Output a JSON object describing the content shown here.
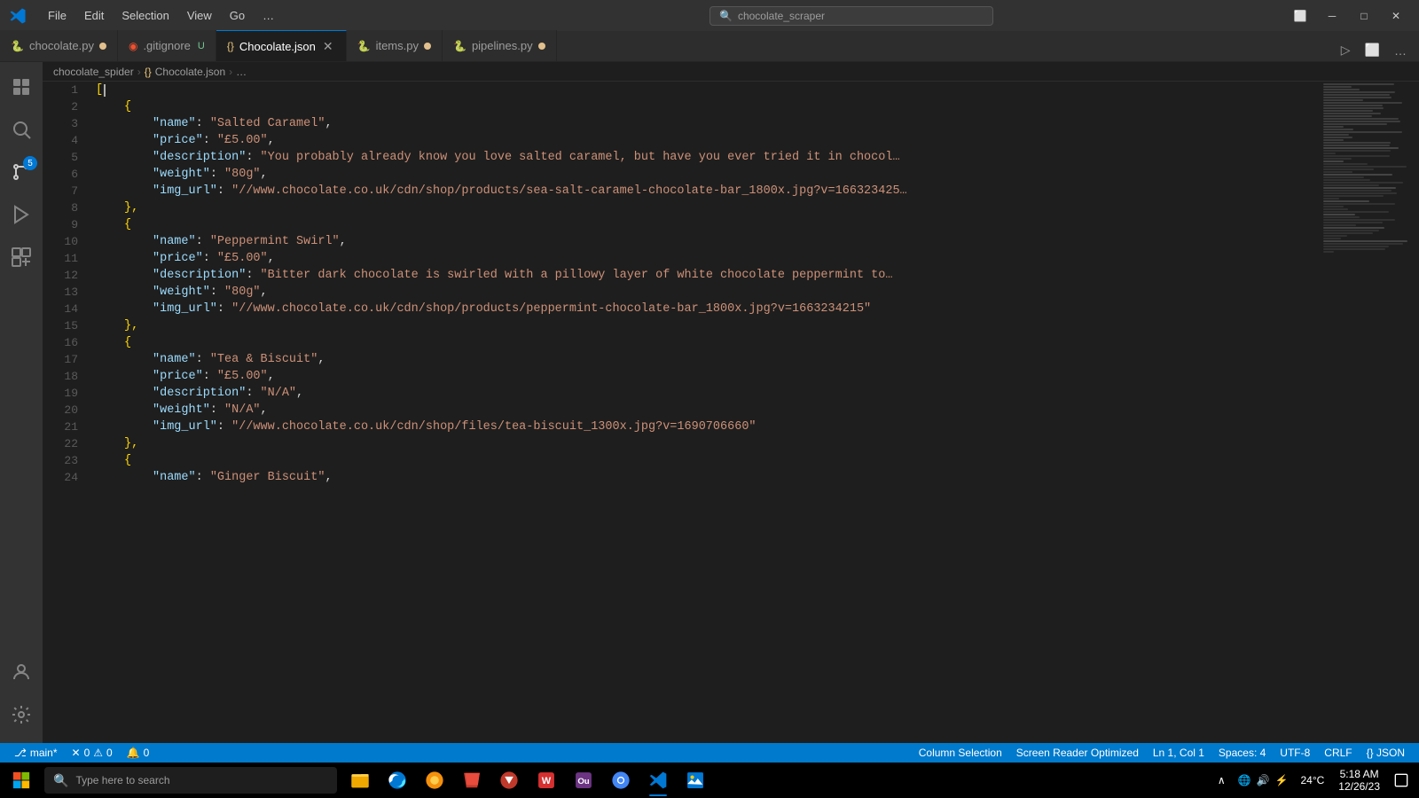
{
  "titlebar": {
    "menu": [
      "File",
      "Edit",
      "Selection",
      "View",
      "Go",
      "…"
    ],
    "search_placeholder": "chocolate_scraper",
    "window_controls": [
      "minimize",
      "maximize",
      "close"
    ]
  },
  "tabs": [
    {
      "id": "chocolate-py",
      "label": "chocolate.py",
      "status": "M",
      "active": false,
      "icon_color": "#4ec9b0"
    },
    {
      "id": "gitignore",
      "label": ".gitignore",
      "status": "U",
      "active": false,
      "icon_color": "#f1502f"
    },
    {
      "id": "chocolate-json",
      "label": "Chocolate.json",
      "status": "",
      "active": true,
      "icon_color": "#e8c47a"
    },
    {
      "id": "items-py",
      "label": "items.py",
      "status": "M",
      "active": false,
      "icon_color": "#4ec9b0"
    },
    {
      "id": "pipelines-py",
      "label": "pipelines.py",
      "status": "M",
      "active": false,
      "icon_color": "#4ec9b0"
    }
  ],
  "breadcrumb": [
    "chocolate_spider",
    "{} Chocolate.json",
    "…"
  ],
  "code_lines": [
    {
      "num": 1,
      "indent": 0,
      "tokens": [
        {
          "type": "bracket",
          "text": "["
        },
        {
          "type": "cursor",
          "text": ""
        }
      ]
    },
    {
      "num": 2,
      "indent": 4,
      "tokens": [
        {
          "type": "brace",
          "text": "{"
        }
      ]
    },
    {
      "num": 3,
      "indent": 8,
      "tokens": [
        {
          "type": "key",
          "text": "\"name\""
        },
        {
          "type": "colon",
          "text": ": "
        },
        {
          "type": "string",
          "text": "\"Salted Caramel\""
        },
        {
          "type": "comma",
          "text": ","
        }
      ]
    },
    {
      "num": 4,
      "indent": 8,
      "tokens": [
        {
          "type": "key",
          "text": "\"price\""
        },
        {
          "type": "colon",
          "text": ": "
        },
        {
          "type": "string",
          "text": "\"£5.00\""
        },
        {
          "type": "comma",
          "text": ","
        }
      ]
    },
    {
      "num": 5,
      "indent": 8,
      "tokens": [
        {
          "type": "key",
          "text": "\"description\""
        },
        {
          "type": "colon",
          "text": ": "
        },
        {
          "type": "string",
          "text": "\"You probably already know you love salted caramel, but have you ever tried it in chocol…"
        }
      ]
    },
    {
      "num": 6,
      "indent": 8,
      "tokens": [
        {
          "type": "key",
          "text": "\"weight\""
        },
        {
          "type": "colon",
          "text": ": "
        },
        {
          "type": "string",
          "text": "\"80g\""
        },
        {
          "type": "comma",
          "text": ","
        }
      ]
    },
    {
      "num": 7,
      "indent": 8,
      "tokens": [
        {
          "type": "key",
          "text": "\"img_url\""
        },
        {
          "type": "colon",
          "text": ": "
        },
        {
          "type": "string",
          "text": "\"//www.chocolate.co.uk/cdn/shop/products/sea-salt-caramel-chocolate-bar_1800x.jpg?v=166323425…"
        }
      ]
    },
    {
      "num": 8,
      "indent": 4,
      "tokens": [
        {
          "type": "brace",
          "text": "},"
        }
      ]
    },
    {
      "num": 9,
      "indent": 4,
      "tokens": [
        {
          "type": "brace",
          "text": "{"
        }
      ]
    },
    {
      "num": 10,
      "indent": 8,
      "tokens": [
        {
          "type": "key",
          "text": "\"name\""
        },
        {
          "type": "colon",
          "text": ": "
        },
        {
          "type": "string",
          "text": "\"Peppermint Swirl\""
        },
        {
          "type": "comma",
          "text": ","
        }
      ]
    },
    {
      "num": 11,
      "indent": 8,
      "tokens": [
        {
          "type": "key",
          "text": "\"price\""
        },
        {
          "type": "colon",
          "text": ": "
        },
        {
          "type": "string",
          "text": "\"£5.00\""
        },
        {
          "type": "comma",
          "text": ","
        }
      ]
    },
    {
      "num": 12,
      "indent": 8,
      "tokens": [
        {
          "type": "key",
          "text": "\"description\""
        },
        {
          "type": "colon",
          "text": ": "
        },
        {
          "type": "string",
          "text": "\"Bitter dark chocolate is swirled with a pillowy layer of white chocolate peppermint to…"
        }
      ]
    },
    {
      "num": 13,
      "indent": 8,
      "tokens": [
        {
          "type": "key",
          "text": "\"weight\""
        },
        {
          "type": "colon",
          "text": ": "
        },
        {
          "type": "string",
          "text": "\"80g\""
        },
        {
          "type": "comma",
          "text": ","
        }
      ]
    },
    {
      "num": 14,
      "indent": 8,
      "tokens": [
        {
          "type": "key",
          "text": "\"img_url\""
        },
        {
          "type": "colon",
          "text": ": "
        },
        {
          "type": "string",
          "text": "\"//www.chocolate.co.uk/cdn/shop/products/peppermint-chocolate-bar_1800x.jpg?v=1663234215\""
        }
      ]
    },
    {
      "num": 15,
      "indent": 4,
      "tokens": [
        {
          "type": "brace",
          "text": "},"
        }
      ]
    },
    {
      "num": 16,
      "indent": 4,
      "tokens": [
        {
          "type": "brace",
          "text": "{"
        }
      ]
    },
    {
      "num": 17,
      "indent": 8,
      "tokens": [
        {
          "type": "key",
          "text": "\"name\""
        },
        {
          "type": "colon",
          "text": ": "
        },
        {
          "type": "string",
          "text": "\"Tea & Biscuit\""
        },
        {
          "type": "comma",
          "text": ","
        }
      ]
    },
    {
      "num": 18,
      "indent": 8,
      "tokens": [
        {
          "type": "key",
          "text": "\"price\""
        },
        {
          "type": "colon",
          "text": ": "
        },
        {
          "type": "string",
          "text": "\"£5.00\""
        },
        {
          "type": "comma",
          "text": ","
        }
      ]
    },
    {
      "num": 19,
      "indent": 8,
      "tokens": [
        {
          "type": "key",
          "text": "\"description\""
        },
        {
          "type": "colon",
          "text": ": "
        },
        {
          "type": "string",
          "text": "\"N/A\""
        },
        {
          "type": "comma",
          "text": ","
        }
      ]
    },
    {
      "num": 20,
      "indent": 8,
      "tokens": [
        {
          "type": "key",
          "text": "\"weight\""
        },
        {
          "type": "colon",
          "text": ": "
        },
        {
          "type": "string",
          "text": "\"N/A\""
        },
        {
          "type": "comma",
          "text": ","
        }
      ]
    },
    {
      "num": 21,
      "indent": 8,
      "tokens": [
        {
          "type": "key",
          "text": "\"img_url\""
        },
        {
          "type": "colon",
          "text": ": "
        },
        {
          "type": "string",
          "text": "\"//www.chocolate.co.uk/cdn/shop/files/tea-biscuit_1300x.jpg?v=1690706660\""
        }
      ]
    },
    {
      "num": 22,
      "indent": 4,
      "tokens": [
        {
          "type": "brace",
          "text": "},"
        }
      ]
    },
    {
      "num": 23,
      "indent": 4,
      "tokens": [
        {
          "type": "brace",
          "text": "{"
        }
      ]
    },
    {
      "num": 24,
      "indent": 8,
      "tokens": [
        {
          "type": "key",
          "text": "\"name\""
        },
        {
          "type": "colon",
          "text": ": "
        },
        {
          "type": "string",
          "text": "\"Ginger Biscuit\""
        },
        {
          "type": "comma",
          "text": ","
        }
      ]
    }
  ],
  "statusbar": {
    "branch": "main*",
    "errors": "0",
    "warnings": "0",
    "info": "0",
    "cursor_pos": "Ln 1, Col 1",
    "spaces": "Spaces: 4",
    "encoding": "UTF-8",
    "line_ending": "CRLF",
    "language": "{} JSON",
    "column_selection": "Column Selection",
    "screen_reader": "Screen Reader Optimized"
  },
  "taskbar": {
    "search_placeholder": "Type here to search",
    "datetime": {
      "time": "5:18 AM",
      "date": "12/26/23"
    },
    "temperature": "24°C"
  },
  "activity": {
    "icons": [
      {
        "name": "explorer-icon",
        "symbol": "⧉",
        "active": false
      },
      {
        "name": "search-icon",
        "symbol": "🔍",
        "active": false
      },
      {
        "name": "source-control-icon",
        "symbol": "⑂",
        "active": false,
        "badge": "5"
      },
      {
        "name": "run-icon",
        "symbol": "▷",
        "active": false
      },
      {
        "name": "extensions-icon",
        "symbol": "⊞",
        "active": false
      }
    ],
    "bottom": [
      {
        "name": "remote-icon",
        "symbol": "⚙"
      },
      {
        "name": "account-icon",
        "symbol": "👤"
      },
      {
        "name": "settings-icon",
        "symbol": "⚙"
      }
    ]
  }
}
